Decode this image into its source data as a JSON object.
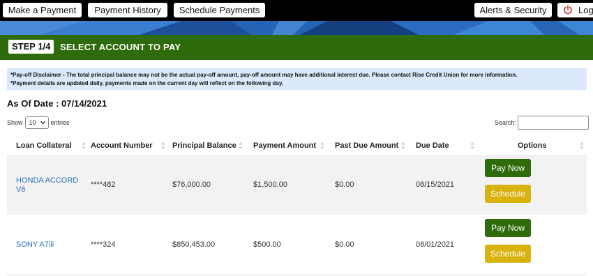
{
  "nav": {
    "make_payment": "Make a Payment",
    "payment_history": "Payment History",
    "schedule_payments": "Schedule Payments",
    "alerts_security": "Alerts & Security",
    "logout": "Log"
  },
  "step": {
    "badge": "STEP 1/4",
    "title": "SELECT ACCOUNT TO PAY"
  },
  "disclaimer": {
    "line1": "*Pay-off Disclaimer - The total principal balance may not be the actual pay-off amount, pay-off amount may have additional interest due. Please contact Rise Credit Union for more information.",
    "line2": "*Payment details are updated daily, payments made on the current day will reflect on the following day."
  },
  "as_of": "As Of Date : 07/14/2021",
  "table_controls": {
    "show_label": "Show",
    "entries_value": "10",
    "entries_label": "entries",
    "search_label": "Search:"
  },
  "columns": [
    "Loan Collateral",
    "Account Number",
    "Principal Balance",
    "Payment Amount",
    "Past Due Amount",
    "Due Date",
    "Options"
  ],
  "rows": [
    {
      "collateral": "HONDA ACCORD V6",
      "account": "****482",
      "principal": "$76,000.00",
      "payment": "$1,500.00",
      "past_due": "$0.00",
      "due_date": "08/15/2021",
      "pay_label": "Pay Now",
      "schedule_label": "Schedule"
    },
    {
      "collateral": "SONY A7iii",
      "account": "****324",
      "principal": "$850,453.00",
      "payment": "$500.00",
      "past_due": "$0.00",
      "due_date": "08/01/2021",
      "pay_label": "Pay Now",
      "schedule_label": "Schedule"
    }
  ],
  "colors": {
    "step_bar": "#2e6b0a",
    "pay_button": "#2e6b0a",
    "schedule_button": "#d8b20d",
    "link": "#2a6ebb",
    "disclaimer_bg": "#dce8fb"
  },
  "icons": {
    "logout": "power-icon",
    "sort": "sort-icon",
    "select_chevron": "chevron-down-icon"
  }
}
